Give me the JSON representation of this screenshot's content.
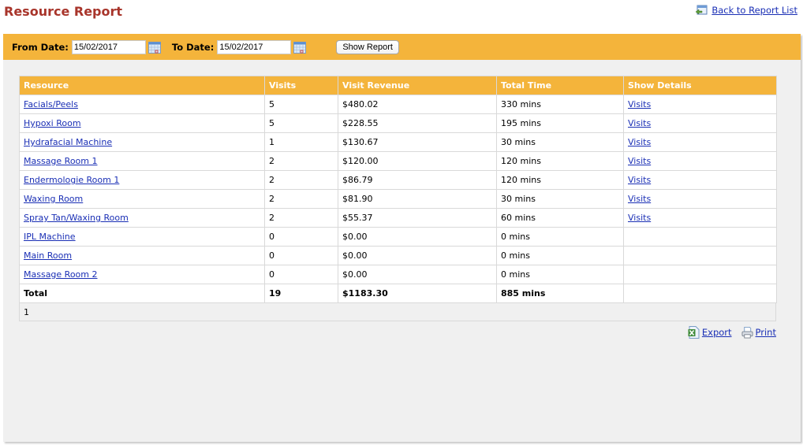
{
  "header": {
    "title": "Resource Report",
    "back_link": "Back to Report List",
    "back_icon": "back-window-icon"
  },
  "filters": {
    "from_label": "From Date:",
    "from_value": "15/02/2017",
    "to_label": "To Date:",
    "to_value": "15/02/2017",
    "calendar_icon": "calendar-icon",
    "show_report_label": "Show Report"
  },
  "table": {
    "columns": [
      "Resource",
      "Visits",
      "Visit Revenue",
      "Total Time",
      "Show Details"
    ],
    "rows": [
      {
        "resource": "Facials/Peels",
        "visits": "5",
        "revenue": "$480.02",
        "time": "330 mins",
        "details": "Visits"
      },
      {
        "resource": "Hypoxi Room",
        "visits": "5",
        "revenue": "$228.55",
        "time": "195 mins",
        "details": "Visits"
      },
      {
        "resource": "Hydrafacial Machine",
        "visits": "1",
        "revenue": "$130.67",
        "time": "30 mins",
        "details": "Visits"
      },
      {
        "resource": "Massage Room 1",
        "visits": "2",
        "revenue": "$120.00",
        "time": "120 mins",
        "details": "Visits"
      },
      {
        "resource": "Endermologie Room 1",
        "visits": "2",
        "revenue": "$86.79",
        "time": "120 mins",
        "details": "Visits"
      },
      {
        "resource": "Waxing Room",
        "visits": "2",
        "revenue": "$81.90",
        "time": "30 mins",
        "details": "Visits"
      },
      {
        "resource": "Spray Tan/Waxing Room",
        "visits": "2",
        "revenue": "$55.37",
        "time": "60 mins",
        "details": "Visits"
      },
      {
        "resource": "IPL Machine",
        "visits": "0",
        "revenue": "$0.00",
        "time": "0 mins",
        "details": ""
      },
      {
        "resource": "Main Room",
        "visits": "0",
        "revenue": "$0.00",
        "time": "0 mins",
        "details": ""
      },
      {
        "resource": "Massage Room 2",
        "visits": "0",
        "revenue": "$0.00",
        "time": "0 mins",
        "details": ""
      }
    ],
    "total": {
      "label": "Total",
      "visits": "19",
      "revenue": "$1183.30",
      "time": "885 mins",
      "details": ""
    },
    "pager": "1"
  },
  "actions": {
    "export_label": "Export",
    "export_icon": "excel-export-icon",
    "print_label": "Print",
    "print_icon": "printer-icon"
  },
  "colors": {
    "accent": "#f4b43b",
    "title": "#a8352b",
    "link": "#1a2fb5",
    "panel_bg": "#f0f0f0"
  }
}
